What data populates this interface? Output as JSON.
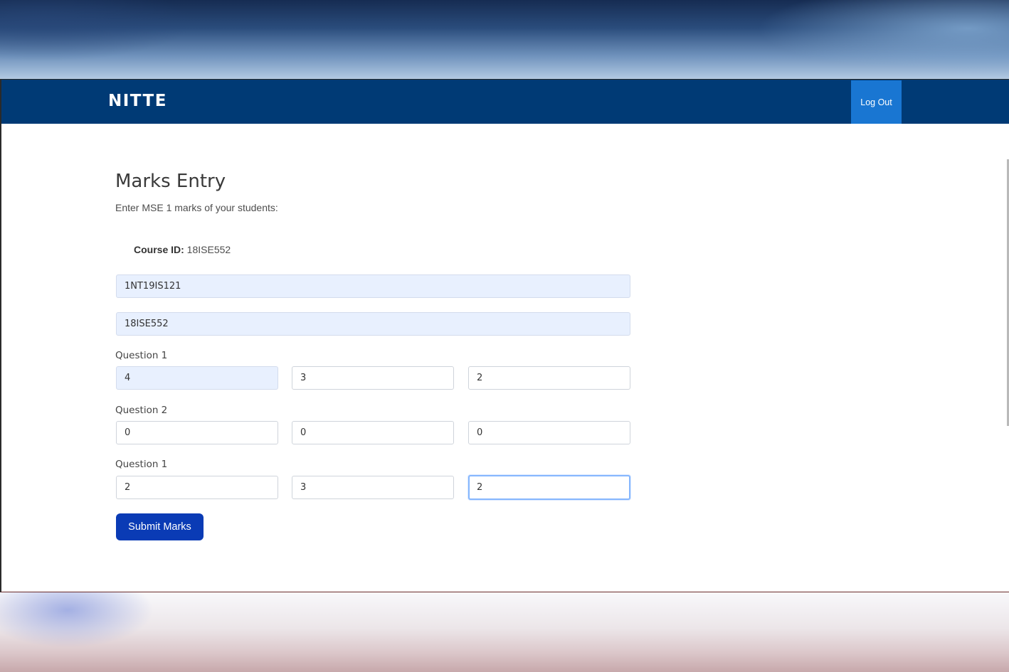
{
  "app": {
    "brand": "NITTE"
  },
  "nav": {
    "logout_label": "Log Out"
  },
  "page": {
    "title": "Marks Entry",
    "subtitle": "Enter MSE 1 marks of your students:",
    "course_label": "Course ID:",
    "course_value": " 18ISE552"
  },
  "form": {
    "usn_value": "1NT19IS121",
    "course_value": "18ISE552",
    "groups": [
      {
        "label": "Question 1",
        "values": [
          "4",
          "3",
          "2"
        ]
      },
      {
        "label": "Question 2",
        "values": [
          "0",
          "0",
          "0"
        ]
      },
      {
        "label": "Question 1",
        "values": [
          "2",
          "3",
          "2"
        ]
      }
    ],
    "submit_label": "Submit Marks"
  }
}
